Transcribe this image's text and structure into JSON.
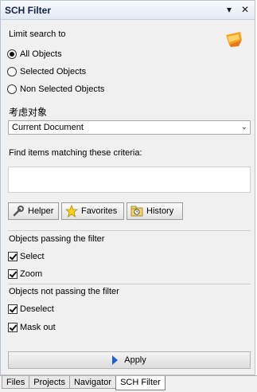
{
  "panel": {
    "title": "SCH Filter",
    "pin_symbol": "▾",
    "close_symbol": "✕"
  },
  "limit": {
    "heading": "Limit search to",
    "options": [
      "All Objects",
      "Selected Objects",
      "Non Selected Objects"
    ],
    "selected": "All Objects"
  },
  "scope": {
    "label": "考虑对象",
    "value": "Current Document"
  },
  "criteria": {
    "label": "Find items matching these criteria:",
    "value": ""
  },
  "buttons": {
    "helper": "Helper",
    "favorites": "Favorites",
    "history": "History"
  },
  "passing": {
    "heading": "Objects passing the filter",
    "select_label": "Select",
    "select_checked": true,
    "zoom_label": "Zoom",
    "zoom_checked": true
  },
  "not_passing": {
    "heading": "Objects not passing the filter",
    "deselect_label": "Deselect",
    "deselect_checked": true,
    "maskout_label": "Mask out",
    "maskout_checked": true
  },
  "apply_label": "Apply",
  "tabs": [
    "Files",
    "Projects",
    "Navigator",
    "SCH Filter"
  ],
  "active_tab": "SCH Filter",
  "colors": {
    "accent": "#1f5fcf",
    "title_text": "#10214a"
  }
}
